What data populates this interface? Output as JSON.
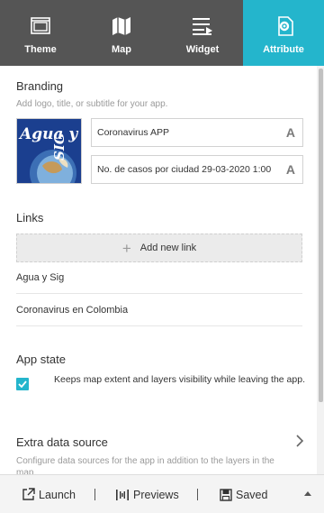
{
  "tabs": [
    {
      "label": "Theme",
      "icon": "theme-icon",
      "active": false
    },
    {
      "label": "Map",
      "icon": "map-icon",
      "active": false
    },
    {
      "label": "Widget",
      "icon": "widget-icon",
      "active": false
    },
    {
      "label": "Attribute",
      "icon": "attribute-gear-icon",
      "active": true
    }
  ],
  "branding": {
    "heading": "Branding",
    "description": "Add logo, title, or subtitle for your app.",
    "logo_text": "Agua y SIG",
    "title_value": "Coronavirus APP",
    "subtitle_value": "No. de casos por ciudad 29-03-2020 1:00",
    "font_icon_glyph": "A"
  },
  "links": {
    "heading": "Links",
    "add_label": "Add new link",
    "items": [
      "Agua y Sig",
      "Coronavirus en Colombia"
    ]
  },
  "app_state": {
    "heading": "App state",
    "checked": true,
    "description": "Keeps map extent and layers visibility while leaving the app."
  },
  "extra_source": {
    "heading": "Extra data source",
    "description": "Configure data sources for the app in addition to the layers in the map."
  },
  "bottom": {
    "launch": "Launch",
    "previews": "Previews",
    "saved": "Saved"
  },
  "colors": {
    "accent": "#24b5cc",
    "tabbar": "#555555"
  }
}
